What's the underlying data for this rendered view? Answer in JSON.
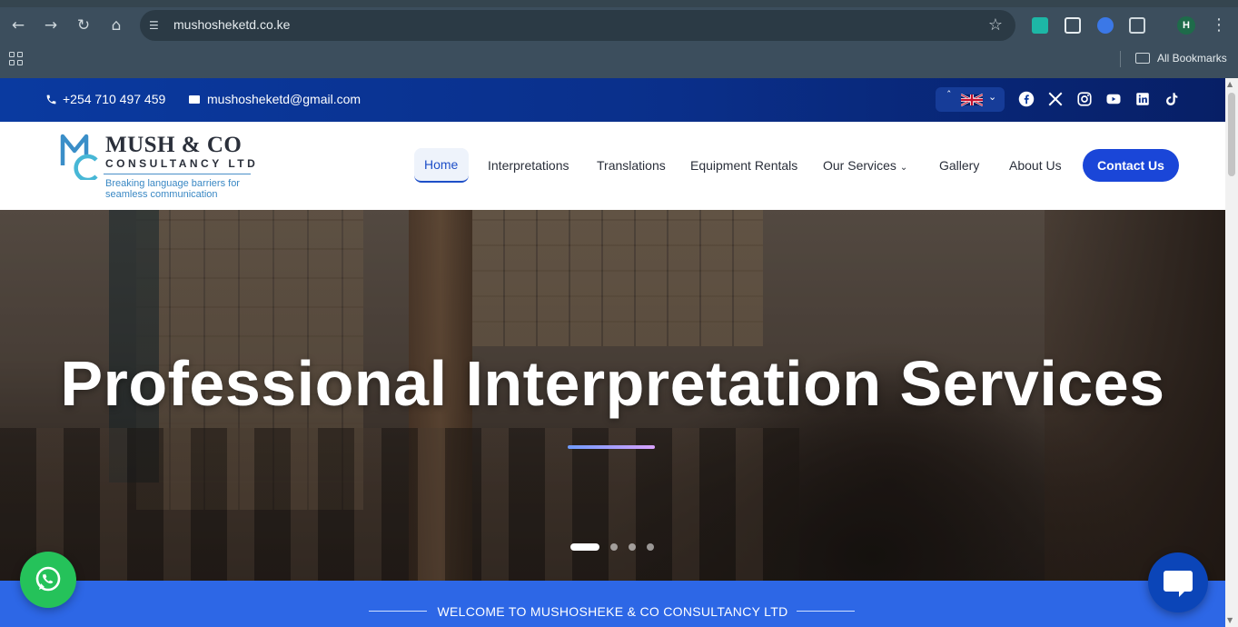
{
  "browser": {
    "url": "mushosheketd.co.ke",
    "profile_initial": "H",
    "bookmarks_label": "All Bookmarks"
  },
  "topbar": {
    "phone": "+254 710 497 459",
    "email": "mushosheketd@gmail.com"
  },
  "brand": {
    "name": "MUSH & CO",
    "sub": "CONSULTANCY LTD",
    "tagline_line1": "Breaking language barriers for",
    "tagline_line2": "seamless communication",
    "colors": {
      "primary": "#1a46d8",
      "logo_blue": "#3a88c4"
    }
  },
  "nav": {
    "items": [
      "Home",
      "Interpretations",
      "Translations",
      "Equipment Rentals",
      "Our Services",
      "Gallery",
      "About Us"
    ],
    "active": "Home",
    "cta": "Contact Us"
  },
  "hero": {
    "title": "Professional Interpretation Services",
    "slide_count": 4,
    "active_slide": 1
  },
  "welcome": {
    "text": "WELCOME TO MUSHOSHEKE & CO CONSULTANCY LTD"
  },
  "icons": {
    "social": [
      "facebook-icon",
      "x-icon",
      "instagram-icon",
      "youtube-icon",
      "linkedin-icon",
      "tiktok-icon"
    ]
  }
}
